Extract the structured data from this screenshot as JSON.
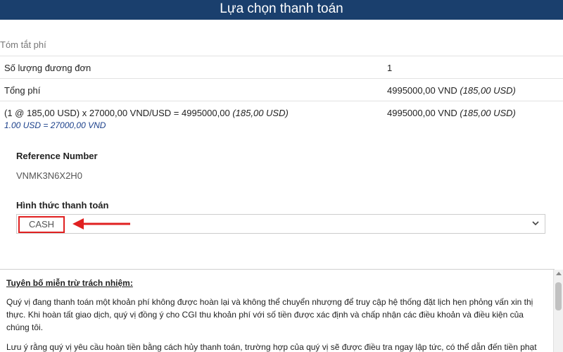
{
  "header": {
    "title": "Lựa chọn thanh toán"
  },
  "summary": {
    "label": "Tóm tắt phí",
    "rows": [
      {
        "label": "Số lượng đương đơn",
        "value": "1",
        "value_usd": ""
      },
      {
        "label": "Tổng phí",
        "value": "4995000,00 VND",
        "value_usd": "(185,00 USD)"
      },
      {
        "label": "(1 @ 185,00 USD) x 27000,00 VND/USD = 4995000,00",
        "label_usd": "(185,00 USD)",
        "value": "4995000,00 VND",
        "value_usd": "(185,00 USD)"
      }
    ],
    "rate": "1.00 USD = 27000,00 VND"
  },
  "reference": {
    "title": "Reference Number",
    "value": "VNMK3N6X2H0"
  },
  "payment": {
    "title": "Hình thức thanh toán",
    "selected": "CASH"
  },
  "disclaimer": {
    "title": "Tuyên bố miễn trừ trách nhiệm:",
    "paragraph1": "Quý vị đang thanh toán một khoản phí không được hoàn lại và không thể chuyển nhượng để truy cập hệ thống đặt lịch hẹn phỏng vấn xin thị thực. Khi hoàn tất giao dịch, quý vị đồng ý cho CGI thu khoản phí với số tiền được xác định và chấp nhận các điều khoản và điều kiện của chúng tôi.",
    "paragraph2": "Lưu ý rằng quý vị yêu cầu hoàn tiền bằng cách hủy thanh toán, trường hợp của quý vị sẽ được điều tra ngay lập tức, có thể dẫn đến tiền phạt"
  },
  "colors": {
    "header_bg": "#1a3f6d",
    "highlight": "#e02020",
    "rate_text": "#1a3f8a"
  },
  "icons": {
    "select_toggle": "chevron-down-icon",
    "annotation": "arrow-left-icon"
  }
}
